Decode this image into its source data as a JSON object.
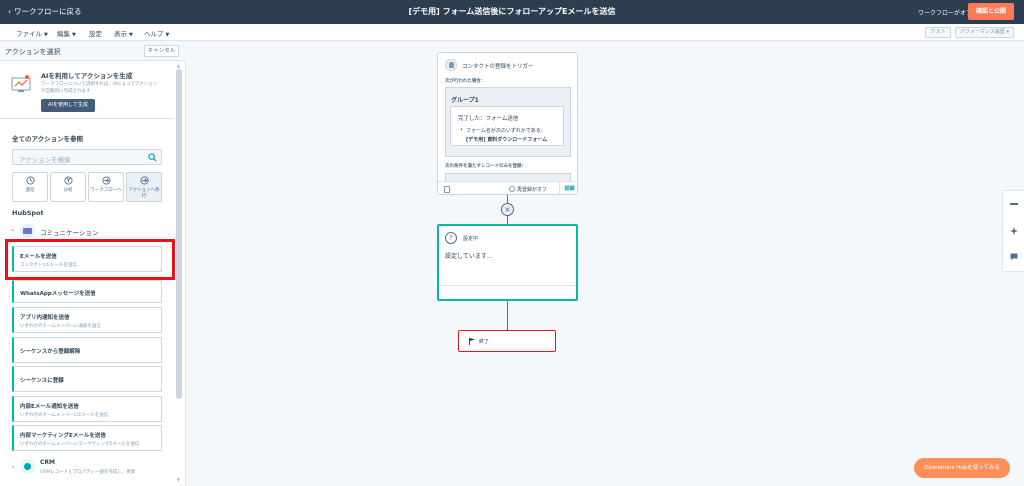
{
  "topbar": {
    "back_label": "ワークフローに戻る",
    "title": "[デモ用] フォーム送信後にフォローアップEメールを送信",
    "status": "ワークフローがオフ",
    "publish_label": "確認と公開"
  },
  "menubar": {
    "items": [
      "ファイル",
      "編集",
      "設定",
      "表示",
      "ヘルプ"
    ],
    "test_label": "テスト",
    "perf_label": "パフォーマンス履歴"
  },
  "panel": {
    "title": "アクションを選択",
    "cancel_label": "キャンセル",
    "ai": {
      "title": "AIを利用してアクションを生成",
      "description": "ワークフローについて説明すれば、AIによってアクションが自動的に作成されます",
      "button_label": "AIを使用して生成"
    },
    "all_actions_label": "全てのアクションを参照",
    "search_placeholder": "アクションを検索",
    "categories": [
      {
        "label": "遅延",
        "icon": "clock-icon"
      },
      {
        "label": "分岐",
        "icon": "branch-icon"
      },
      {
        "label": "ワークフローへ",
        "icon": "arrow-icon"
      },
      {
        "label": "アクションへ移行",
        "icon": "arrow-icon"
      }
    ],
    "section_label": "HubSpot",
    "group_label": "コミュニケーション",
    "actions": [
      {
        "title": "Eメールを送信",
        "subtitle": "コンタクトにEメールを送信"
      },
      {
        "title": "WhatsAppメッセージを送信",
        "subtitle": ""
      },
      {
        "title": "アプリ内通知を送信",
        "subtitle": "いずれかのチームメンバーに通知を送信"
      },
      {
        "title": "シーケンスから登録解除",
        "subtitle": ""
      },
      {
        "title": "シーケンスに登録",
        "subtitle": ""
      },
      {
        "title": "内部Eメール通知を送信",
        "subtitle": "いずれかのチームメンバーにEメールを送信"
      },
      {
        "title": "内部マーケティングEメールを送信",
        "subtitle": "いずれかのチームメンバーにマーケティングEメールを送信"
      }
    ],
    "crm": {
      "label": "CRM",
      "description": "CRMレコードとプロパティー値を作成し、更新"
    }
  },
  "canvas": {
    "trigger": {
      "title": "コンタクトの登録をトリガー",
      "when_label": "次が行われた場合：",
      "group_label": "グループ1",
      "condition_title": "完了した：フォーム送信",
      "condition_line1": "フォーム名が次のいずれかである：",
      "condition_line2": "[デモ用] 資料ダウンロードフォーム",
      "next_label": "次の条件を満たすレコードのみを登録：",
      "reenroll_label": "再登録がオフ",
      "details_label": "詳細"
    },
    "action_node": {
      "title": "設定中",
      "body": "設定しています..."
    },
    "end_label": "終了"
  },
  "ops_button_label": "Operations Hubを使ってみる",
  "colors": {
    "topbar": "#2d3e50",
    "accent_orange": "#ff7a59",
    "teal": "#00bda5",
    "highlight_red": "#e8121a"
  }
}
